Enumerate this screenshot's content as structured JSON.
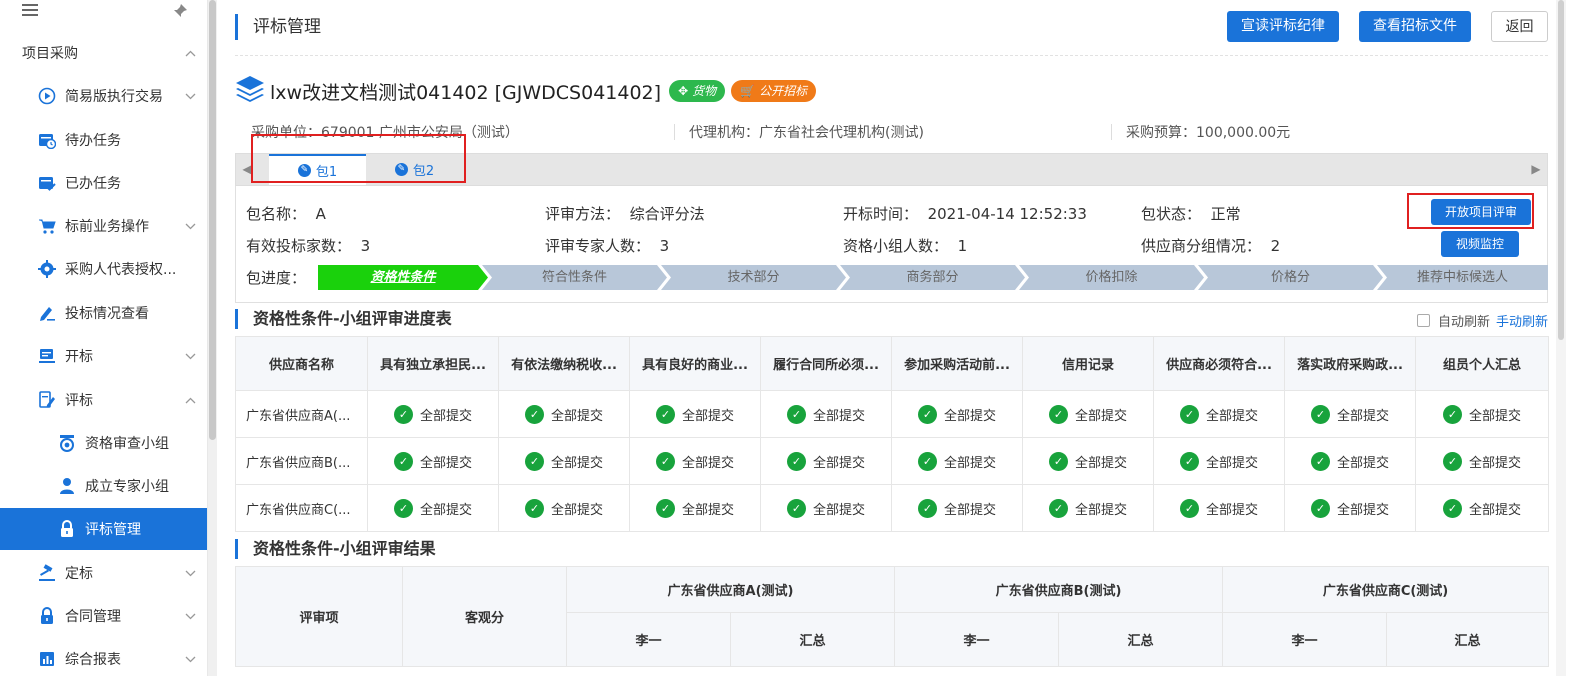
{
  "sidebar": {
    "items": [
      {
        "label": "项目采购",
        "icon": "none",
        "level": 0,
        "arrow": "up"
      },
      {
        "label": "简易版执行交易",
        "icon": "play-circle-icon",
        "level": 1,
        "arrow": "down"
      },
      {
        "label": "待办任务",
        "icon": "calendar-clock-icon",
        "level": 1,
        "arrow": ""
      },
      {
        "label": "已办任务",
        "icon": "calendar-check-icon",
        "level": 1,
        "arrow": ""
      },
      {
        "label": "标前业务操作",
        "icon": "cart-icon",
        "level": 1,
        "arrow": "down"
      },
      {
        "label": "采购人代表授权...",
        "icon": "gear-icon",
        "level": 1,
        "arrow": ""
      },
      {
        "label": "投标情况查看",
        "icon": "pen-icon",
        "level": 1,
        "arrow": ""
      },
      {
        "label": "开标",
        "icon": "monitor-icon",
        "level": 1,
        "arrow": "down"
      },
      {
        "label": "评标",
        "icon": "edit-doc-icon",
        "level": 1,
        "arrow": "up"
      },
      {
        "label": "资格审查小组",
        "icon": "badge-icon",
        "level": 2,
        "arrow": ""
      },
      {
        "label": "成立专家小组",
        "icon": "person-icon",
        "level": 2,
        "arrow": ""
      },
      {
        "label": "评标管理",
        "icon": "lock-icon",
        "level": 2,
        "arrow": "",
        "active": true
      },
      {
        "label": "定标",
        "icon": "gavel-icon",
        "level": 1,
        "arrow": "down"
      },
      {
        "label": "合同管理",
        "icon": "lock-icon",
        "level": 1,
        "arrow": "down"
      },
      {
        "label": "综合报表",
        "icon": "report-icon",
        "level": 1,
        "arrow": "down"
      }
    ]
  },
  "header": {
    "title": "评标管理",
    "btn_discipline": "宣读评标纪律",
    "btn_view_doc": "查看招标文件",
    "btn_back": "返回"
  },
  "project": {
    "name": "lxw改进文档测试041402 [GJWDCS041402]",
    "badge_goods": "货物",
    "badge_public": "公开招标",
    "purchaser": "采购单位：679001 广州市公安局（测试）",
    "agency": "代理机构：广东省社会代理机构(测试)",
    "budget": "采购预算：100,000.00元"
  },
  "tabs": [
    "包1",
    "包2"
  ],
  "package": {
    "name_label": "包名称：",
    "name_value": "A",
    "method_label": "评审方法：",
    "method_value": "综合评分法",
    "open_time_label": "开标时间：",
    "open_time_value": "2021-04-14 12:52:33",
    "status_label": "包状态：",
    "status_value": "正常",
    "bidders_label": "有效投标家数：",
    "bidders_value": "3",
    "experts_label": "评审专家人数：",
    "experts_value": "3",
    "qual_group_label": "资格小组人数：",
    "qual_group_value": "1",
    "supplier_group_label": "供应商分组情况：",
    "supplier_group_value": "2",
    "btn_open_review": "开放项目评审",
    "btn_video": "视频监控",
    "progress_label": "包进度：",
    "steps": [
      "资格性条件",
      "符合性条件",
      "技术部分",
      "商务部分",
      "价格扣除",
      "价格分",
      "推荐中标候选人"
    ]
  },
  "progress_section": {
    "title": "资格性条件-小组评审进度表",
    "auto_refresh": "自动刷新",
    "manual_refresh": "手动刷新",
    "columns": [
      "供应商名称",
      "具有独立承担民...",
      "有依法缴纳税收...",
      "具有良好的商业...",
      "履行合同所必须...",
      "参加采购活动前...",
      "信用记录",
      "供应商必须符合...",
      "落实政府采购政...",
      "组员个人汇总"
    ],
    "rows": [
      {
        "supplier": "广东省供应商A(...",
        "cells": [
          "全部提交",
          "全部提交",
          "全部提交",
          "全部提交",
          "全部提交",
          "全部提交",
          "全部提交",
          "全部提交",
          "全部提交"
        ]
      },
      {
        "supplier": "广东省供应商B(...",
        "cells": [
          "全部提交",
          "全部提交",
          "全部提交",
          "全部提交",
          "全部提交",
          "全部提交",
          "全部提交",
          "全部提交",
          "全部提交"
        ]
      },
      {
        "supplier": "广东省供应商C(...",
        "cells": [
          "全部提交",
          "全部提交",
          "全部提交",
          "全部提交",
          "全部提交",
          "全部提交",
          "全部提交",
          "全部提交",
          "全部提交"
        ]
      }
    ]
  },
  "result_section": {
    "title": "资格性条件-小组评审结果",
    "col_item": "评审项",
    "col_objective": "客观分",
    "suppliers": [
      "广东省供应商A(测试)",
      "广东省供应商B(测试)",
      "广东省供应商C(测试)"
    ],
    "sub_member": "李一",
    "sub_total": "汇总"
  },
  "colors": {
    "primary": "#1a73d9",
    "done_step": "#1ad10c",
    "pending_step": "#b8c7d9",
    "highlight_box": "#e02020",
    "badge_goods": "#2db84d",
    "badge_public": "#f07a18"
  }
}
